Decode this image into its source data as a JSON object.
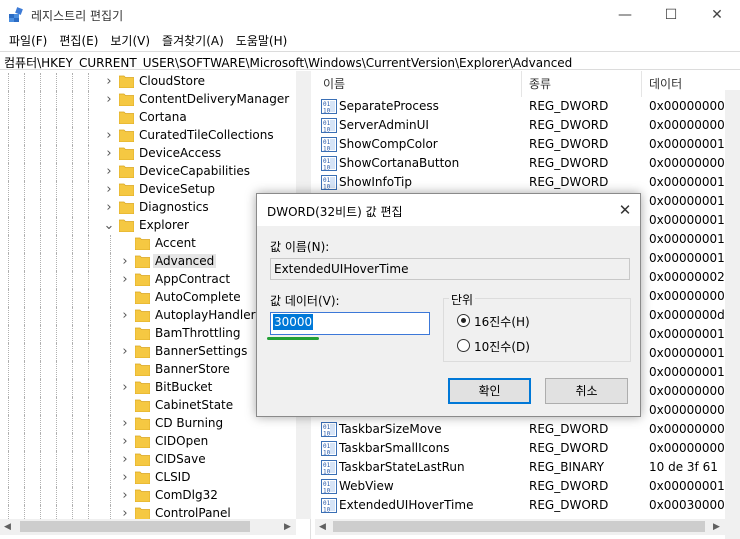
{
  "window": {
    "title": "레지스트리 편집기",
    "min_glyph": "—",
    "max_glyph": "☐",
    "close_glyph": "✕"
  },
  "menu": [
    "파일(F)",
    "편집(E)",
    "보기(V)",
    "즐겨찾기(A)",
    "도움말(H)"
  ],
  "address": "컴퓨터\\HKEY_CURRENT_USER\\SOFTWARE\\Microsoft\\Windows\\CurrentVersion\\Explorer\\Advanced",
  "tree": [
    {
      "label": "CloudStore",
      "level": 1,
      "expand": "closed"
    },
    {
      "label": "ContentDeliveryManager",
      "level": 1,
      "expand": "closed"
    },
    {
      "label": "Cortana",
      "level": 1,
      "expand": "none"
    },
    {
      "label": "CuratedTileCollections",
      "level": 1,
      "expand": "closed"
    },
    {
      "label": "DeviceAccess",
      "level": 1,
      "expand": "closed"
    },
    {
      "label": "DeviceCapabilities",
      "level": 1,
      "expand": "closed"
    },
    {
      "label": "DeviceSetup",
      "level": 1,
      "expand": "closed"
    },
    {
      "label": "Diagnostics",
      "level": 1,
      "expand": "closed"
    },
    {
      "label": "Explorer",
      "level": 1,
      "expand": "open"
    },
    {
      "label": "Accent",
      "level": 2,
      "expand": "none"
    },
    {
      "label": "Advanced",
      "level": 2,
      "expand": "closed",
      "selected": true
    },
    {
      "label": "AppContract",
      "level": 2,
      "expand": "closed"
    },
    {
      "label": "AutoComplete",
      "level": 2,
      "expand": "none"
    },
    {
      "label": "AutoplayHandlers",
      "level": 2,
      "expand": "closed"
    },
    {
      "label": "BamThrottling",
      "level": 2,
      "expand": "none"
    },
    {
      "label": "BannerSettings",
      "level": 2,
      "expand": "closed"
    },
    {
      "label": "BannerStore",
      "level": 2,
      "expand": "none"
    },
    {
      "label": "BitBucket",
      "level": 2,
      "expand": "closed"
    },
    {
      "label": "CabinetState",
      "level": 2,
      "expand": "none"
    },
    {
      "label": "CD Burning",
      "level": 2,
      "expand": "closed"
    },
    {
      "label": "CIDOpen",
      "level": 2,
      "expand": "closed"
    },
    {
      "label": "CIDSave",
      "level": 2,
      "expand": "closed"
    },
    {
      "label": "CLSID",
      "level": 2,
      "expand": "closed"
    },
    {
      "label": "ComDlg32",
      "level": 2,
      "expand": "closed"
    },
    {
      "label": "ControlPanel",
      "level": 2,
      "expand": "closed"
    }
  ],
  "columns": {
    "name": "이름",
    "type": "종류",
    "data": "데이터"
  },
  "values": [
    {
      "name": "SeparateProcess",
      "type": "REG_DWORD",
      "data": "0x00000000"
    },
    {
      "name": "ServerAdminUI",
      "type": "REG_DWORD",
      "data": "0x00000000"
    },
    {
      "name": "ShowCompColor",
      "type": "REG_DWORD",
      "data": "0x00000001"
    },
    {
      "name": "ShowCortanaButton",
      "type": "REG_DWORD",
      "data": "0x00000000"
    },
    {
      "name": "ShowInfoTip",
      "type": "REG_DWORD",
      "data": "0x00000001"
    },
    {
      "name": "",
      "type": "",
      "data": "0x00000001"
    },
    {
      "name": "",
      "type": "",
      "data": "0x00000001"
    },
    {
      "name": "",
      "type": "",
      "data": "0x00000001"
    },
    {
      "name": "",
      "type": "",
      "data": "0x00000001"
    },
    {
      "name": "",
      "type": "",
      "data": "0x00000002"
    },
    {
      "name": "",
      "type": "",
      "data": "0x00000000"
    },
    {
      "name": "",
      "type": "",
      "data": "0x0000000d"
    },
    {
      "name": "",
      "type": "",
      "data": "0x00000001"
    },
    {
      "name": "",
      "type": "",
      "data": "0x00000001"
    },
    {
      "name": "",
      "type": "",
      "data": "0x00000001"
    },
    {
      "name": "",
      "type": "",
      "data": "0x00000000"
    },
    {
      "name": "",
      "type": "",
      "data": "0x00000000"
    },
    {
      "name": "TaskbarSizeMove",
      "type": "REG_DWORD",
      "data": "0x00000000"
    },
    {
      "name": "TaskbarSmallIcons",
      "type": "REG_DWORD",
      "data": "0x00000000"
    },
    {
      "name": "TaskbarStateLastRun",
      "type": "REG_BINARY",
      "data": "10 de 3f 61"
    },
    {
      "name": "WebView",
      "type": "REG_DWORD",
      "data": "0x00000001"
    },
    {
      "name": "ExtendedUIHoverTime",
      "type": "REG_DWORD",
      "data": "0x00030000"
    }
  ],
  "dialog": {
    "title": "DWORD(32비트) 값 편집",
    "close_glyph": "✕",
    "name_label": "값 이름(N):",
    "name_value": "ExtendedUIHoverTime",
    "data_label": "값 데이터(V):",
    "data_value": "30000",
    "base_label": "단위",
    "hex_label": "16진수(H)",
    "dec_label": "10진수(D)",
    "hex_selected": true,
    "ok_label": "확인",
    "cancel_label": "취소"
  },
  "colors": {
    "accent": "#0078d7",
    "highlight_underline": "#22a035",
    "folder": "#f5c842"
  }
}
